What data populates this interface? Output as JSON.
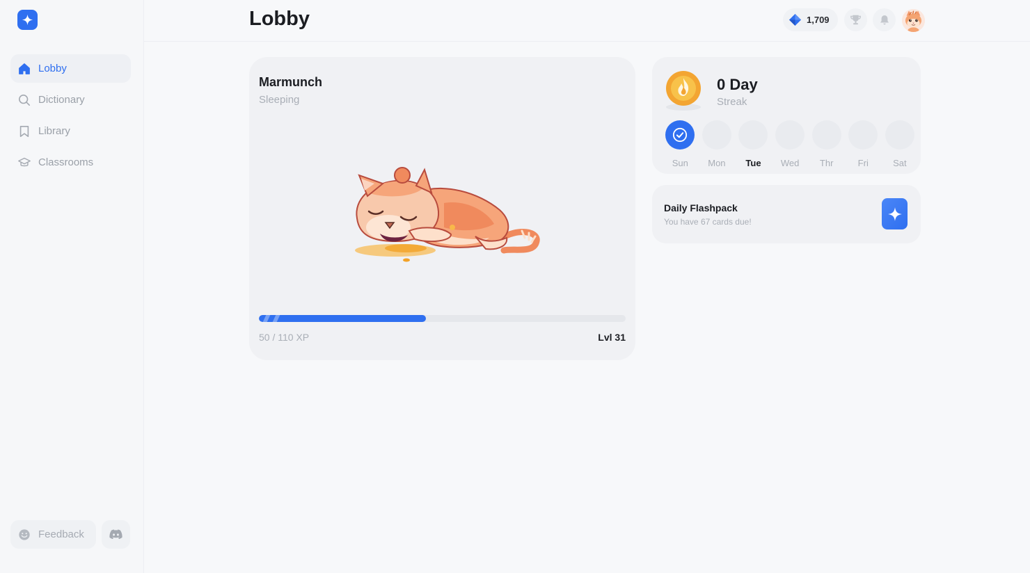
{
  "sidebar": {
    "items": [
      {
        "label": "Lobby",
        "icon": "home-icon",
        "active": true
      },
      {
        "label": "Dictionary",
        "icon": "search-icon",
        "active": false
      },
      {
        "label": "Library",
        "icon": "bookmark-icon",
        "active": false
      },
      {
        "label": "Classrooms",
        "icon": "graduation-cap-icon",
        "active": false
      }
    ],
    "feedback_label": "Feedback"
  },
  "header": {
    "title": "Lobby",
    "gems": "1,709"
  },
  "pet": {
    "name": "Marmunch",
    "status": "Sleeping",
    "xp_text": "50 / 110 XP",
    "xp_current": 50,
    "xp_max": 110,
    "level_text": "Lvl 31"
  },
  "streak": {
    "days_text": "0 Day",
    "label": "Streak",
    "week": [
      {
        "label": "Sun",
        "done": true,
        "today": false
      },
      {
        "label": "Mon",
        "done": false,
        "today": false
      },
      {
        "label": "Tue",
        "done": false,
        "today": true
      },
      {
        "label": "Wed",
        "done": false,
        "today": false
      },
      {
        "label": "Thr",
        "done": false,
        "today": false
      },
      {
        "label": "Fri",
        "done": false,
        "today": false
      },
      {
        "label": "Sat",
        "done": false,
        "today": false
      }
    ]
  },
  "flashpack": {
    "title": "Daily Flashpack",
    "subtitle": "You have 67 cards due!"
  },
  "colors": {
    "accent": "#2f6ff0",
    "muted_text": "#a9aeb6",
    "card_bg": "#f0f1f4"
  }
}
